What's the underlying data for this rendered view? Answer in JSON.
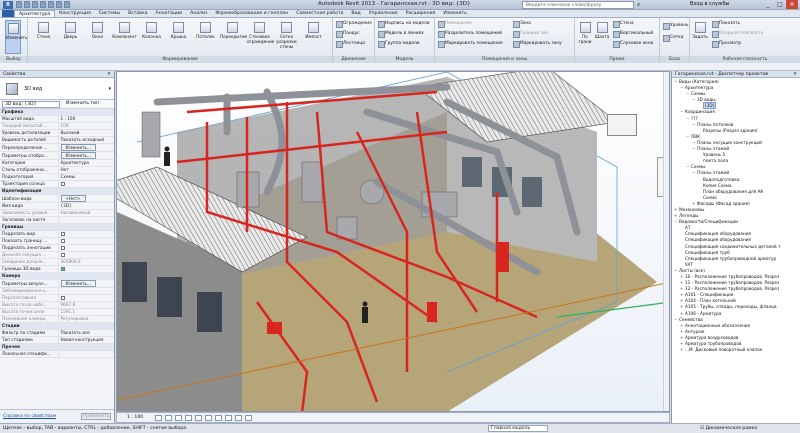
{
  "window": {
    "app_logo": "R",
    "title": "Autodesk Revit 2013 -    Гагаринская.rvt - 3D вид: {3D}",
    "search_placeholder": "Введите ключевое слово/фразу",
    "login": "Вход в службы",
    "minimize": "_",
    "maximize": "□",
    "close": "✕"
  },
  "ribbon_tabs": [
    "Архитектура",
    "Конструкция",
    "Системы",
    "Вставка",
    "Аннотации",
    "Анализ",
    "Формообразование и генплан",
    "Совместная работа",
    "Вид",
    "Управление",
    "Расширения",
    "Изменить"
  ],
  "ribbon_active_tab": "Архитектура",
  "ribbon": {
    "select": {
      "button": "Изменить",
      "label": "Выбор"
    },
    "build": {
      "buttons": [
        "Стена",
        "Дверь",
        "Окно",
        "Компонент",
        "Колонна",
        "Крыша",
        "Потолок",
        "Перекрытие",
        "Стеновое ограждение",
        "Сетка разрезки стены",
        "Импост"
      ],
      "label": "Формирование"
    },
    "circulation": {
      "items": [
        "Ограждение",
        "Пандус",
        "Лестница"
      ],
      "label": "Движение"
    },
    "model": {
      "items": [
        "Надпись на модели",
        "Модель в линиях",
        "Группа модели"
      ],
      "label": "Модель"
    },
    "room": {
      "items": [
        "Помещение",
        "Разделитель помещений",
        "Маркировать помещение",
        "Зона",
        "Граница зон",
        "Маркировать зону"
      ],
      "label": "Помещения и зоны"
    },
    "opening": {
      "items": [
        "По грани",
        "Шахта",
        "Стена",
        "Вертикальный",
        "Слуховое окно"
      ],
      "label": "Проем"
    },
    "datum": {
      "items": [
        "Уровень",
        "Сетка"
      ],
      "label": "База"
    },
    "work_plane": {
      "items": [
        "Задать",
        "Показать",
        "Опорная плоскость",
        "Просмотр"
      ],
      "label": "Рабочая плоскость"
    }
  },
  "properties": {
    "title": "Свойства",
    "type_name": "3D вид",
    "instance_selector": "3D вид: {3D}",
    "edit_type": "Изменить тип",
    "rows": [
      {
        "k": "Графика",
        "v": "",
        "group": true
      },
      {
        "k": "Масштаб вида",
        "v": "1 : 100"
      },
      {
        "k": "Текущий масштаб ...",
        "v": "100",
        "ro": true
      },
      {
        "k": "Уровень детализации",
        "v": "Высокий"
      },
      {
        "k": "Видимость деталей",
        "v": "Показать исходный"
      },
      {
        "k": "Переопределения ...",
        "v": "Изменить...",
        "btn": true
      },
      {
        "k": "Параметры отобра...",
        "v": "Изменить...",
        "btn": true
      },
      {
        "k": "Категория",
        "v": "Архитектура"
      },
      {
        "k": "Стиль отображени...",
        "v": "Нет"
      },
      {
        "k": "Подкатегория",
        "v": "Схемы"
      },
      {
        "k": "Траектория солнца",
        "v": "",
        "chk": false
      },
      {
        "k": "Идентификация",
        "v": "",
        "group": true
      },
      {
        "k": "Шаблон вида",
        "v": "<Нет>",
        "btn": true
      },
      {
        "k": "Имя вида",
        "v": "{3D}"
      },
      {
        "k": "Зависимость уровня",
        "v": "Независимый",
        "ro": true
      },
      {
        "k": "Заголовок на листе",
        "v": ""
      },
      {
        "k": "Границы",
        "v": "",
        "group": true
      },
      {
        "k": "Подрезать вид",
        "v": "",
        "chk": false
      },
      {
        "k": "Показать границу ...",
        "v": "",
        "chk": false
      },
      {
        "k": "Подрезать аннотации",
        "v": "",
        "chk": false
      },
      {
        "k": "Дальняя секущая ...",
        "v": "",
        "chk": false,
        "ro": true
      },
      {
        "k": "Смещение дальне...",
        "v": "304800.0",
        "ro": true
      },
      {
        "k": "Границы 3D вида",
        "v": "",
        "chk": true
      },
      {
        "k": "Камера",
        "v": "",
        "group": true
      },
      {
        "k": "Параметры визуал...",
        "v": "Изменить...",
        "btn": true
      },
      {
        "k": "Заблокированная о...",
        "v": "",
        "ro": true
      },
      {
        "k": "Перспективная",
        "v": "",
        "chk": false,
        "ro": true
      },
      {
        "k": "Высота глаза набл...",
        "v": "9667.8",
        "ro": true
      },
      {
        "k": "Высота точки цели",
        "v": "1591.1",
        "ro": true
      },
      {
        "k": "Положение камеры",
        "v": "Регулировка",
        "ro": true
      },
      {
        "k": "Стадии",
        "v": "",
        "group": true
      },
      {
        "k": "Фильтр по стадиям",
        "v": "Показать все"
      },
      {
        "k": "Тип стадиями",
        "v": "Новая конструкция"
      },
      {
        "k": "Прочее",
        "v": "",
        "group": true
      },
      {
        "k": "Локальная специфи...",
        "v": ""
      }
    ],
    "help_link": "Справка по свойствам",
    "apply": "Применить"
  },
  "view_controls": {
    "scale": "1 : 100"
  },
  "project_browser": {
    "title": "Гагаринская.rvt - Диспетчер проектов",
    "nodes": [
      {
        "d": 0,
        "t": "−",
        "l": "Виды (Категория)"
      },
      {
        "d": 1,
        "t": "−",
        "l": "Архитектура"
      },
      {
        "d": 2,
        "t": "−",
        "l": "Схемы"
      },
      {
        "d": 3,
        "t": "−",
        "l": "3D виды"
      },
      {
        "d": 4,
        "t": "",
        "l": "{3D}",
        "sel": true
      },
      {
        "d": 1,
        "t": "−",
        "l": "Координация"
      },
      {
        "d": 2,
        "t": "−",
        "l": "???"
      },
      {
        "d": 3,
        "t": "−",
        "l": "Планы потолков"
      },
      {
        "d": 4,
        "t": "",
        "l": "Разрезы (Разрез здания)"
      },
      {
        "d": 2,
        "t": "−",
        "l": "ОВК"
      },
      {
        "d": 3,
        "t": "−",
        "l": "Планы несущих конструкций"
      },
      {
        "d": 3,
        "t": "−",
        "l": "Планы этажей"
      },
      {
        "d": 4,
        "t": "",
        "l": "Уровень 5"
      },
      {
        "d": 4,
        "t": "",
        "l": "плита пола"
      },
      {
        "d": 2,
        "t": "−",
        "l": "Схемы"
      },
      {
        "d": 3,
        "t": "−",
        "l": "Планы этажей"
      },
      {
        "d": 4,
        "t": "",
        "l": "Водоподготовка"
      },
      {
        "d": 4,
        "t": "",
        "l": "Копия Схема"
      },
      {
        "d": 4,
        "t": "",
        "l": "План оборудования для АК"
      },
      {
        "d": 4,
        "t": "",
        "l": "Схема"
      },
      {
        "d": 3,
        "t": "+",
        "l": "Фасады (Фасад здания)"
      },
      {
        "d": 0,
        "t": "+",
        "l": "Механизмы"
      },
      {
        "d": 0,
        "t": "+",
        "l": "Легенды"
      },
      {
        "d": 0,
        "t": "−",
        "l": "Ведомости/Спецификации"
      },
      {
        "d": 1,
        "t": "",
        "l": "АТ"
      },
      {
        "d": 1,
        "t": "",
        "l": "Спецификация оборудования"
      },
      {
        "d": 1,
        "t": "",
        "l": "Спецификация оборудования"
      },
      {
        "d": 1,
        "t": "",
        "l": "Спецификация соединительных деталей т"
      },
      {
        "d": 1,
        "t": "",
        "l": "Спецификация труб"
      },
      {
        "d": 1,
        "t": "",
        "l": "Спецификация трубопроводной арматур"
      },
      {
        "d": 1,
        "t": "",
        "l": "УАТ"
      },
      {
        "d": 0,
        "t": "−",
        "l": "Листы (все)"
      },
      {
        "d": 1,
        "t": "+",
        "l": "10 - Расположение трубопроводов. Разрез"
      },
      {
        "d": 1,
        "t": "+",
        "l": "11 - Расположение трубопроводов. Разрез"
      },
      {
        "d": 1,
        "t": "+",
        "l": "12 - Расположение трубопроводов. Разрез"
      },
      {
        "d": 1,
        "t": "+",
        "l": "А101 - Спецификация"
      },
      {
        "d": 1,
        "t": "+",
        "l": "А104 - План котельной"
      },
      {
        "d": 1,
        "t": "+",
        "l": "А105 - Трубы, отводы, переходы, фланца"
      },
      {
        "d": 1,
        "t": "+",
        "l": "А106 - Арматура"
      },
      {
        "d": 0,
        "t": "−",
        "l": "Семейства"
      },
      {
        "d": 1,
        "t": "+",
        "l": "Аннотационные обозначения"
      },
      {
        "d": 1,
        "t": "+",
        "l": "Антураж"
      },
      {
        "d": 1,
        "t": "+",
        "l": "Арматура воздуховодов"
      },
      {
        "d": 1,
        "t": "+",
        "l": "Арматура трубопроводов"
      },
      {
        "d": 1,
        "t": "+",
        "l": "...М. Дисковый поворотный клапан"
      }
    ]
  },
  "status_bar": {
    "message": "Щелчок - выбор, TAB - варианты, CTRL - добавление, SHIFT - снятие выбора.",
    "model": "Главная модель",
    "dynamic_frame": "Динамическая рамка"
  },
  "colors": {
    "pipe_red": "#d8261f",
    "pipe_gray": "#8e9197",
    "floor_tan": "#b9a77a",
    "sky_blue": "#dbe8f6"
  }
}
